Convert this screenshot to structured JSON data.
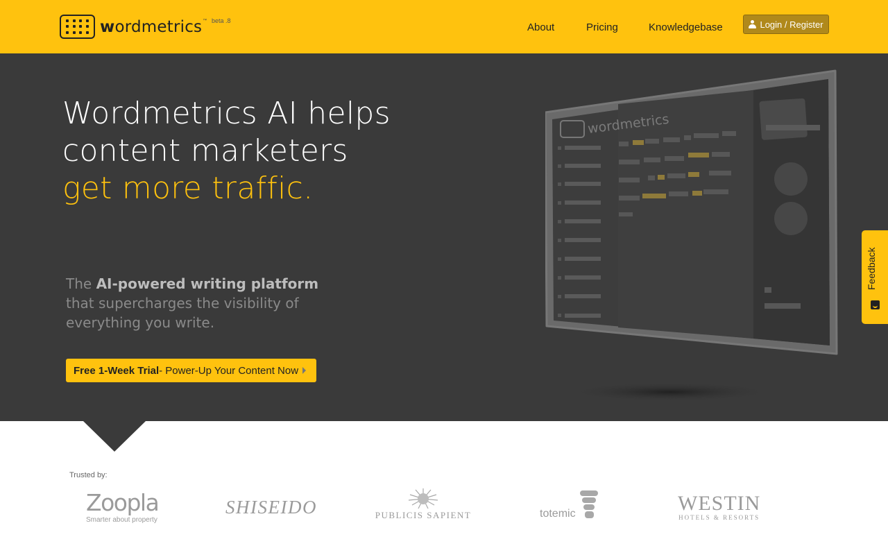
{
  "header": {
    "logo_text_bold": "w",
    "logo_text_rest": "ordmetrics",
    "trademark": "™",
    "beta_label": "beta .8",
    "nav": {
      "about": "About",
      "pricing": "Pricing",
      "knowledgebase": "Knowledgebase"
    },
    "login_label": "Login / Register",
    "login_icon": "user-icon"
  },
  "hero": {
    "headline_line1": "Wordmetrics AI helps",
    "headline_line2": "content marketers",
    "headline_accent": "get more traffic.",
    "subtitle_lead": "The ",
    "subtitle_bold": "AI-powered writing platform",
    "subtitle_rest": " that supercharges the visibility of everything you write.",
    "cta_bold": "Free 1-Week Trial",
    "cta_rest": " - Power-Up Your Content Now",
    "mockup_logo_text": "wordmetrics"
  },
  "feedback": {
    "label": "Feedback",
    "icon": "smile-icon"
  },
  "trusted": {
    "label": "Trusted by:",
    "clients": [
      {
        "name": "Zoopla",
        "tagline": "Smarter about property"
      },
      {
        "name": "SHISEIDO"
      },
      {
        "name": "PUBLICIS SAPIENT"
      },
      {
        "name": "totemic"
      },
      {
        "name": "WESTIN",
        "tagline": "HOTELS & RESORTS"
      }
    ]
  },
  "colors": {
    "brand_yellow": "#ffc20e",
    "hero_background": "#3a3a3a",
    "login_button": "#b0891b",
    "logo_grey": "#9a9a9a"
  }
}
